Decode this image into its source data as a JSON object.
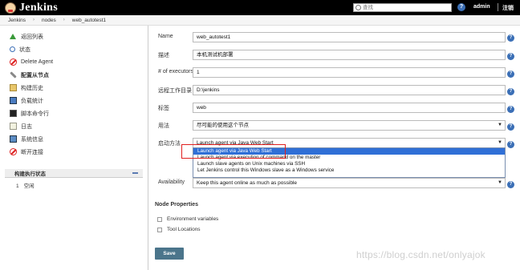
{
  "app": {
    "title": "Jenkins"
  },
  "topbar": {
    "search_placeholder": "查找",
    "help_icon": "?",
    "user": "admin",
    "logout": "注销"
  },
  "breadcrumb": [
    "Jenkins",
    "nodes",
    "web_autotest1"
  ],
  "sidebar": {
    "items": [
      {
        "label": "返回列表",
        "icon": "arrow-up-icon"
      },
      {
        "label": "状态",
        "icon": "search-icon"
      },
      {
        "label": "Delete Agent",
        "icon": "no-entry-icon"
      },
      {
        "label": "配置从节点",
        "icon": "wrench-icon",
        "bold": true
      },
      {
        "label": "构建历史",
        "icon": "notepad-icon"
      },
      {
        "label": "负载统计",
        "icon": "chart-icon"
      },
      {
        "label": "脚本命令行",
        "icon": "terminal-icon"
      },
      {
        "label": "日志",
        "icon": "clipboard-icon"
      },
      {
        "label": "系统信息",
        "icon": "monitor-icon"
      },
      {
        "label": "断开连接",
        "icon": "no-entry-icon"
      }
    ],
    "executor": {
      "title": "构建执行状态",
      "rows": [
        {
          "num": "1",
          "status": "空闲"
        }
      ]
    }
  },
  "form": {
    "name": {
      "label": "Name",
      "value": "web_autotest1"
    },
    "description": {
      "label": "描述",
      "value": "本机测试机部署"
    },
    "executors": {
      "label": "# of executors",
      "value": "1"
    },
    "remote_dir": {
      "label": "远程工作目录",
      "value": "D:\\jenkins"
    },
    "labels": {
      "label": "标签",
      "value": "web"
    },
    "usage": {
      "label": "用法",
      "value": "尽可能的使用这个节点"
    },
    "launch": {
      "label": "启动方法",
      "value": "Launch agent via Java Web Start",
      "options": [
        "Launch agent via Java Web Start",
        "Launch agent via execution of command on the master",
        "Launch slave agents on Unix machines via SSH",
        "Let Jenkins control this Windows slave as a Windows service"
      ]
    },
    "availability": {
      "label": "Availability",
      "value": "Keep this agent online as much as possible"
    },
    "node_properties": {
      "title": "Node Properties",
      "items": [
        "Environment variables",
        "Tool Locations"
      ]
    },
    "save_label": "Save"
  },
  "watermark": "https://blog.csdn.net/onlyajok"
}
